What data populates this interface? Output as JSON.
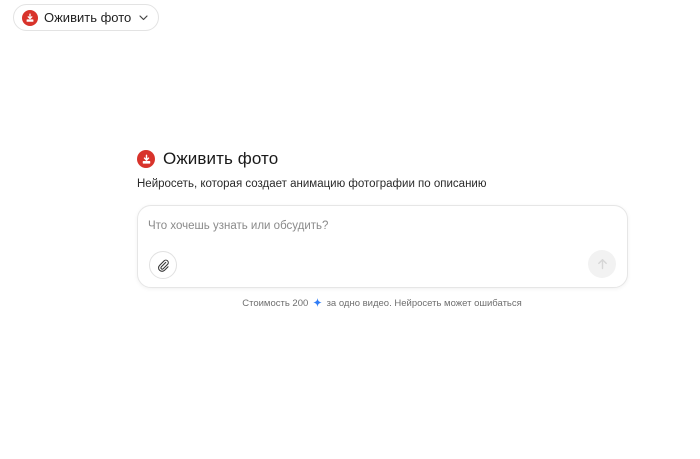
{
  "header": {
    "selector_label": "Оживить фото",
    "logo_icon": "download-tray-icon",
    "chevron_icon": "chevron-down-icon"
  },
  "main": {
    "title": "Оживить фото",
    "subtitle": "Нейросеть, которая создает анимацию фотографии по описанию"
  },
  "composer": {
    "placeholder": "Что хочешь узнать или обсудить?",
    "attach_icon": "paperclip-icon",
    "send_icon": "arrow-up-icon"
  },
  "footer": {
    "cost_prefix": "Стоимость 200",
    "cost_suffix": "за одно видео. Нейросеть может ошибаться",
    "spark_icon": "sparkle-icon"
  },
  "colors": {
    "brand": "#d8332b",
    "spark": "#2f7cf6"
  }
}
